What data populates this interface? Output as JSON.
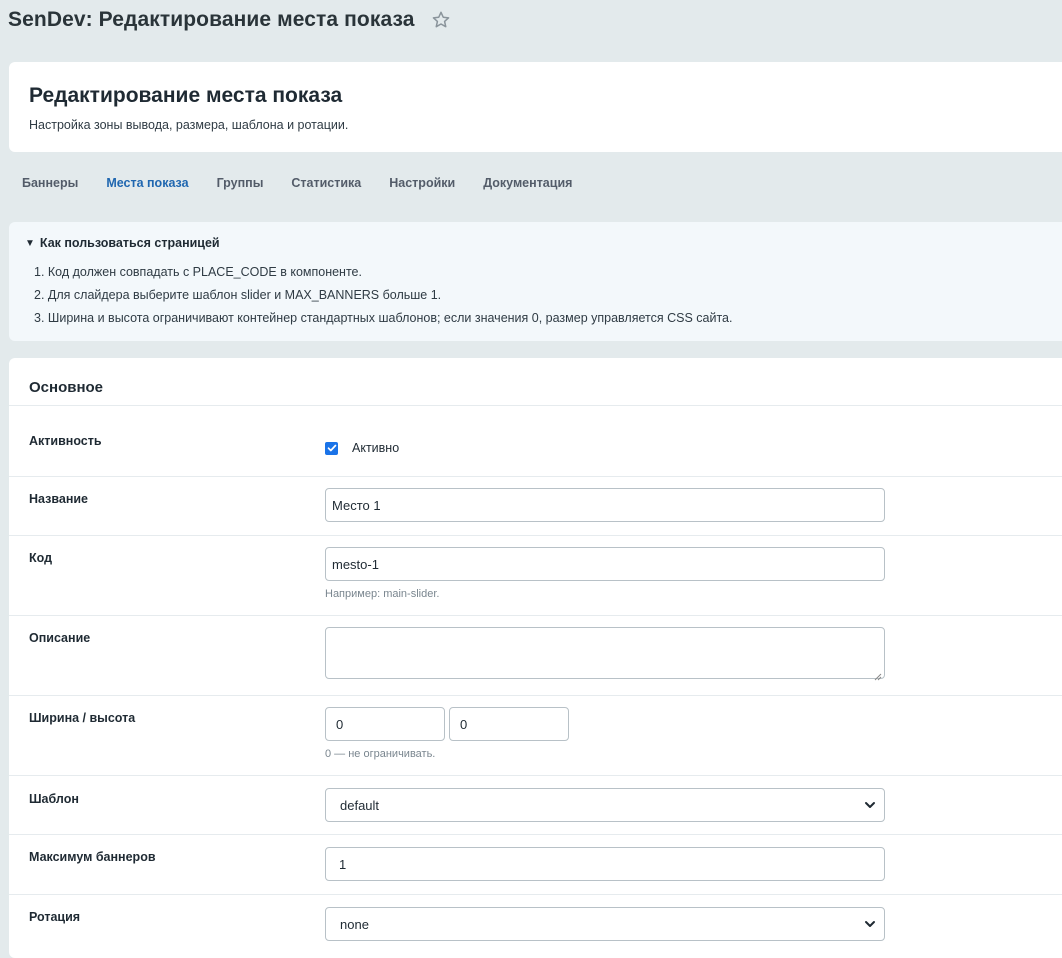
{
  "page": {
    "title": "SenDev: Редактирование места показа"
  },
  "header": {
    "title": "Редактирование места показа",
    "subtitle": "Настройка зоны вывода, размера, шаблона и ротации."
  },
  "tabs": [
    {
      "label": "Баннеры",
      "active": false
    },
    {
      "label": "Места показа",
      "active": true
    },
    {
      "label": "Группы",
      "active": false
    },
    {
      "label": "Статистика",
      "active": false
    },
    {
      "label": "Настройки",
      "active": false
    },
    {
      "label": "Документация",
      "active": false
    }
  ],
  "help": {
    "summary": "Как пользоваться страницей",
    "items": [
      "1. Код должен совпадать с PLACE_CODE в компоненте.",
      "2. Для слайдера выберите шаблон slider и MAX_BANNERS больше 1.",
      "3. Ширина и высота ограничивают контейнер стандартных шаблонов; если значения 0, размер управляется CSS сайта."
    ]
  },
  "form": {
    "section_title": "Основное",
    "active": {
      "label": "Активность",
      "checkbox_label": "Активно",
      "checked": true
    },
    "name": {
      "label": "Название",
      "value": "Место 1"
    },
    "code": {
      "label": "Код",
      "value": "mesto-1",
      "hint": "Например: main-slider."
    },
    "description": {
      "label": "Описание",
      "value": ""
    },
    "size": {
      "label": "Ширина / высота",
      "width": "0",
      "height": "0",
      "hint": "0 — не ограничивать."
    },
    "template": {
      "label": "Шаблон",
      "value": "default"
    },
    "max_banners": {
      "label": "Максимум баннеров",
      "value": "1"
    },
    "rotation": {
      "label": "Ротация",
      "value": "none"
    }
  },
  "colors": {
    "background": "#e3eaec",
    "accent": "#2067b0",
    "checkbox": "#1a73e8"
  }
}
